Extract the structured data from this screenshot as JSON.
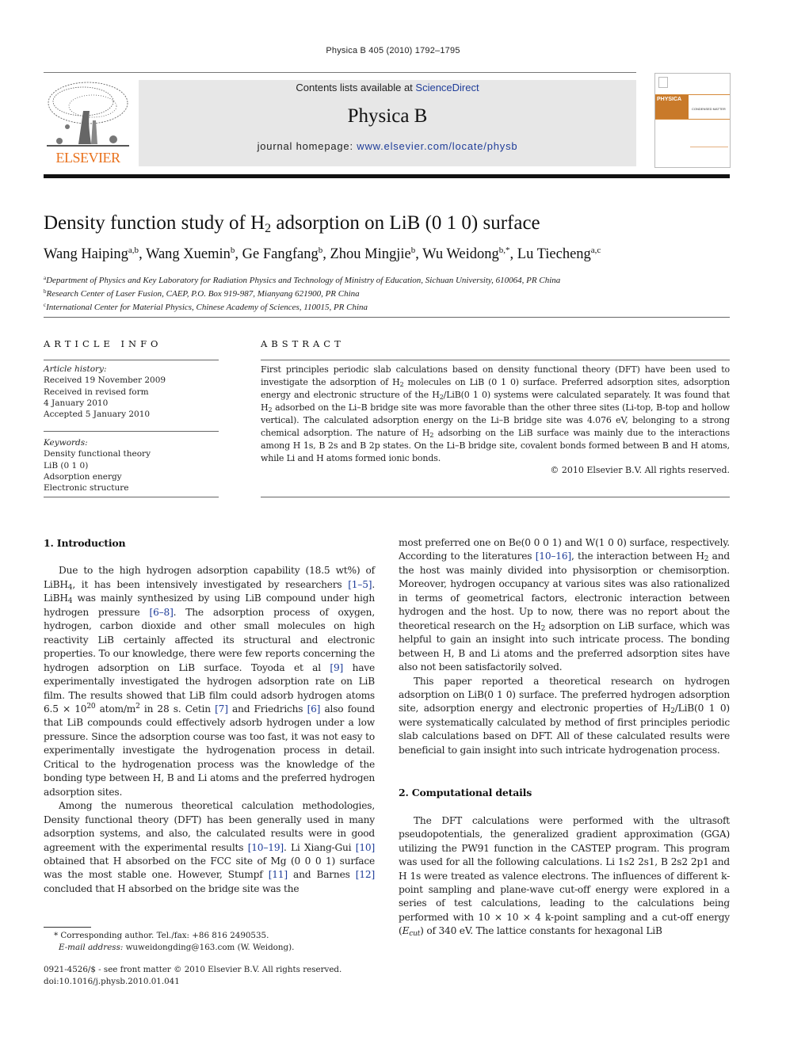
{
  "running_head": "Physica B 405 (2010) 1792–1795",
  "masthead": {
    "publisher_logo": "ELSEVIER",
    "contents_prefix": "Contents lists available at ",
    "contents_link": "ScienceDirect",
    "journal_title": "Physica B",
    "homepage_prefix": "journal homepage: ",
    "homepage_link": "www.elsevier.com/locate/physb",
    "cover_title": "PHYSICA",
    "cover_subtitle": "CONDENSED MATTER",
    "brand_color": "#e9711c",
    "link_color": "#1f3d99"
  },
  "article": {
    "title_pre": "Density function study of H",
    "title_sub": "2",
    "title_post": " adsorption on LiB (0 1 0) surface",
    "authors": [
      {
        "name": "Wang Haiping",
        "sup": "a,b"
      },
      {
        "name": "Wang Xuemin",
        "sup": "b"
      },
      {
        "name": "Ge Fangfang",
        "sup": "b"
      },
      {
        "name": "Zhou Mingjie",
        "sup": "b"
      },
      {
        "name": "Wu Weidong",
        "sup": "b,*"
      },
      {
        "name": "Lu Tiecheng",
        "sup": "a,c"
      }
    ],
    "affiliations": [
      {
        "mark": "a",
        "text": "Department of Physics and Key Laboratory for Radiation Physics and Technology of Ministry of Education, Sichuan University, 610064, PR China"
      },
      {
        "mark": "b",
        "text": "Research Center of Laser Fusion, CAEP, P.O. Box 919-987, Mianyang 621900, PR China"
      },
      {
        "mark": "c",
        "text": "International Center for Material Physics, Chinese Academy of Sciences, 110015, PR China"
      }
    ]
  },
  "article_info": {
    "heading": "ARTICLE INFO",
    "history_label": "Article history:",
    "history": [
      "Received 19 November 2009",
      "Received in revised form",
      "4 January 2010",
      "Accepted 5 January 2010"
    ],
    "keywords_label": "Keywords:",
    "keywords": [
      "Density functional theory",
      "LiB (0 1 0)",
      "Adsorption energy",
      "Electronic structure"
    ]
  },
  "abstract": {
    "heading": "ABSTRACT",
    "s1": "First principles periodic slab calculations based on density functional theory (DFT) have been used to investigate the adsorption of H",
    "s2": " molecules on LiB (0 1 0) surface. Preferred adsorption sites, adsorption energy and electronic structure of the H",
    "s3": "/LiB(0 1 0) systems were calculated separately. It was found that H",
    "s4": " adsorbed on the Li–B bridge site was more favorable than the other three sites (Li-top, B-top and hollow vertical). The calculated adsorption energy on the Li–B bridge site was 4.076 eV, belonging to a strong chemical adsorption. The nature of H",
    "s5": " adsorbing on the LiB surface was mainly due to the interactions among H 1s, B 2s and B 2p states. On the Li–B bridge site, covalent bonds formed between B and H atoms, while Li and H atoms formed ionic bonds.",
    "sub": "2",
    "copyright": "© 2010 Elsevier B.V. All rights reserved."
  },
  "sections": {
    "intro_heading": "1.  Introduction",
    "p1": {
      "a": "Due to the high hydrogen adsorption capability (18.5 wt%) of LiBH",
      "sub4": "4",
      "b": ", it has been intensively investigated by researchers ",
      "ref1": "[1–5]",
      "c": ". LiBH",
      "d": " was mainly synthesized by using LiB compound under high hydrogen pressure ",
      "ref2": "[6–8]",
      "e": ". The adsorption process of oxygen, hydrogen, carbon dioxide and other small molecules on high reactivity LiB certainly affected its structural and electronic properties. To our knowledge, there were few reports concerning the hydrogen adsorption on LiB surface. Toyoda et al ",
      "ref3": "[9]",
      "f": " have experimentally investigated the hydrogen adsorption rate on LiB film. The results showed that LiB film could adsorb hydrogen atoms 6.5 × 10",
      "sup20": "20",
      "g": " atom/m",
      "sup2": "2",
      "h": " in 28 s. Cetin ",
      "ref4": "[7]",
      "i": " and Friedrichs ",
      "ref5": "[6]",
      "j": " also found that LiB compounds could effectively adsorb hydrogen under a low pressure. Since the adsorption course was too fast, it was not easy to experimentally investigate the hydrogenation process in detail. Critical to the hydrogenation process was the knowledge of the bonding type between H, B and Li atoms and the preferred hydrogen adsorption sites."
    },
    "p2": {
      "a": "Among the numerous theoretical calculation methodologies, Density functional theory (DFT) has been generally used in many adsorption systems, and also, the calculated results were in good agreement with the experimental results ",
      "ref1": "[10–19]",
      "b": ". Li Xiang-Gui ",
      "ref2": "[10]",
      "c": " obtained that H absorbed on the FCC site of Mg (0 0 0 1) surface was the most stable one. However, Stumpf ",
      "ref3": "[11]",
      "d": " and Barnes ",
      "ref4": "[12]",
      "e": " concluded that H absorbed on the bridge site was the most preferred one on Be(0 0 0 1) and W(1 0 0) surface, respectively. According to the literatures ",
      "ref5": "[10–16]",
      "f": ", the interaction between H",
      "sub2": "2",
      "g": " and the host was mainly divided into physisorption or chemisorption. Moreover, hydrogen occupancy at various sites was also rationalized in terms of geometrical factors, electronic interaction between hydrogen and the host. Up to now, there was no report about the theoretical research on the H",
      "h": " adsorption on LiB surface, which was helpful to gain an insight into such intricate process. The bonding between H, B and Li atoms and the preferred adsorption sites have also not been satisfactorily solved."
    },
    "p3": {
      "a": "This paper reported a theoretical research on hydrogen adsorption on LiB(0 1 0) surface. The preferred hydrogen adsorption site, adsorption energy and electronic properties of H",
      "sub2": "2",
      "b": "/LiB(0 1 0) were systematically calculated by method of first principles periodic slab calculations based on DFT. All of these calculated results were beneficial to gain insight into such intricate hydrogenation process."
    },
    "comp_heading": "2.  Computational details",
    "p4": {
      "a": "The DFT calculations were performed with the ultrasoft pseudopotentials, the generalized gradient approximation (GGA) utilizing the PW91 function in the CASTEP program. This program was used for all the following calculations. Li 1s2 2s1, B 2s2 2p1 and H 1s were treated as valence electrons. The influences of different k-point sampling and plane-wave cut-off energy were explored in a series of test calculations, leading to the calculations being performed with 10 × 10 × 4 k-point sampling and a cut-off energy (",
      "ecut_e": "E",
      "ecut_sub": "cut",
      "b": ") of 340 eV. The lattice constants for hexagonal LiB"
    }
  },
  "footnote": {
    "star_line": "* Corresponding author. Tel./fax:  +86 816 2490535.",
    "email_label": "E-mail address:",
    "email_value": " wuweidongding@163.com (W. Weidong)."
  },
  "front_matter": {
    "issn_line": "0921-4526/$ - see front matter © 2010 Elsevier B.V. All rights reserved.",
    "doi": "doi:10.1016/j.physb.2010.01.041"
  }
}
